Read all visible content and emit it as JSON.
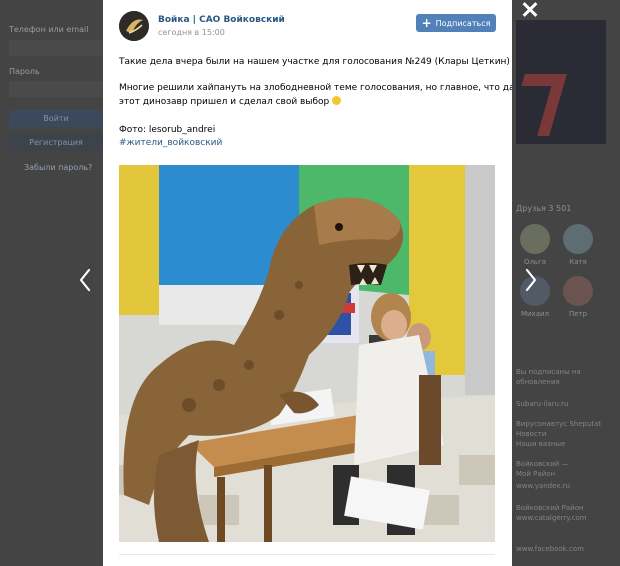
{
  "background": {
    "left_panel": {
      "phone_label": "Телефон или email",
      "password_label": "Пароль",
      "login_button": "Войти",
      "register_button": "Регистрация",
      "forgot_link": "Забыли пароль?"
    },
    "right_panel": {
      "friends_heading": "Друзья 3 501",
      "friends": [
        "Ольга",
        "Катя",
        "Михаил",
        "Петр"
      ],
      "side_texts": [
        "Вы подписаны на",
        "обновления",
        "Subaru-ilaru.ru",
        "Вирусонавтус Sheputat",
        "Новости",
        "Наши вазные",
        "Войковский —",
        "Мой Район",
        "www.yandex.ru",
        "Войковский Район",
        "www.catalgerry.com",
        "www.facebook.com"
      ]
    }
  },
  "overlay": {
    "close_icon": "close-icon",
    "prev_icon": "chevron-left-icon",
    "next_icon": "chevron-right-icon"
  },
  "post": {
    "author": "Войка | САО Войковский",
    "time": "сегодня в 15:00",
    "subscribe_label": "Подписаться",
    "subscribe_icon": "plus-icon",
    "text_line1": "Такие дела вчера были на нашем участке для голосования №249 (Клары Цеткин)",
    "text_line2": "Многие решили хайпануть на злободневной теме голосования, но главное, что даже",
    "text_line3": "этот динозавр пришел и сделал свой выбор",
    "photo_credit": "Фото: lesorub_andrei",
    "hashtag": "#жители_войковский",
    "photo_icon": "photo-image",
    "colors": {
      "link": "#2a5885",
      "button": "#5181b8",
      "meta": "#939393"
    }
  }
}
